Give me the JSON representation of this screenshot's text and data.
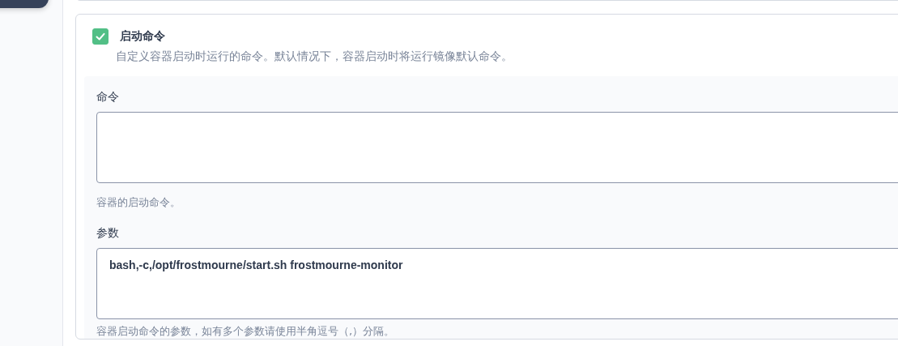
{
  "startup_command": {
    "enabled": true,
    "title": "启动命令",
    "description": "自定义容器启动时运行的命令。默认情况下，容器启动时将运行镜像默认命令。"
  },
  "fields": [
    {
      "label": "命令",
      "help": "容器的启动命令。"
    },
    {
      "label": "参数",
      "value": "bash,-c,/opt/frostmourne/start.sh frostmourne-monitor",
      "help": "容器启动命令的参数，如有多个参数请使用半角逗号（,）分隔。"
    }
  ]
}
